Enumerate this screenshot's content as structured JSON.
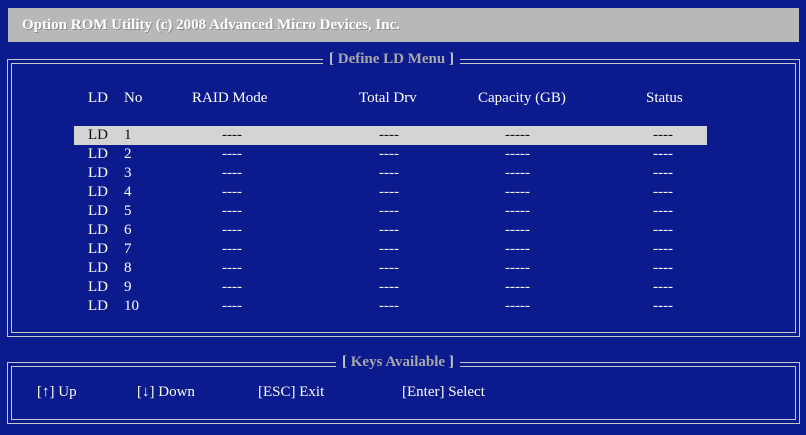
{
  "title": "Option ROM Utility (c) 2008 Advanced Micro Devices, Inc.",
  "define_panel": {
    "title_open": "[ ",
    "title": "Define LD Menu",
    "title_close": " ]",
    "headers": {
      "ld": "LD",
      "no": "No",
      "raid": "RAID Mode",
      "drv": "Total Drv",
      "cap": "Capacity (GB)",
      "status": "Status"
    },
    "rows": [
      {
        "ld": "LD",
        "no": "1",
        "raid": "----",
        "drv": "----",
        "cap": "-----",
        "status": "----",
        "selected": true
      },
      {
        "ld": "LD",
        "no": "2",
        "raid": "----",
        "drv": "----",
        "cap": "-----",
        "status": "----"
      },
      {
        "ld": "LD",
        "no": "3",
        "raid": "----",
        "drv": "----",
        "cap": "-----",
        "status": "----"
      },
      {
        "ld": "LD",
        "no": "4",
        "raid": "----",
        "drv": "----",
        "cap": "-----",
        "status": "----"
      },
      {
        "ld": "LD",
        "no": "5",
        "raid": "----",
        "drv": "----",
        "cap": "-----",
        "status": "----"
      },
      {
        "ld": "LD",
        "no": "6",
        "raid": "----",
        "drv": "----",
        "cap": "-----",
        "status": "----"
      },
      {
        "ld": "LD",
        "no": "7",
        "raid": "----",
        "drv": "----",
        "cap": "-----",
        "status": "----"
      },
      {
        "ld": "LD",
        "no": "8",
        "raid": "----",
        "drv": "----",
        "cap": "-----",
        "status": "----"
      },
      {
        "ld": "LD",
        "no": "9",
        "raid": "----",
        "drv": "----",
        "cap": "-----",
        "status": "----"
      },
      {
        "ld": "LD",
        "no": "10",
        "raid": "----",
        "drv": "----",
        "cap": "-----",
        "status": "----"
      }
    ]
  },
  "keys_panel": {
    "title_open": "[ ",
    "title": "Keys Available",
    "title_close": " ]",
    "keys": [
      {
        "label": "[↑] Up"
      },
      {
        "label": "[↓] Down"
      },
      {
        "label": "[ESC] Exit"
      },
      {
        "label": "[Enter] Select"
      }
    ]
  }
}
